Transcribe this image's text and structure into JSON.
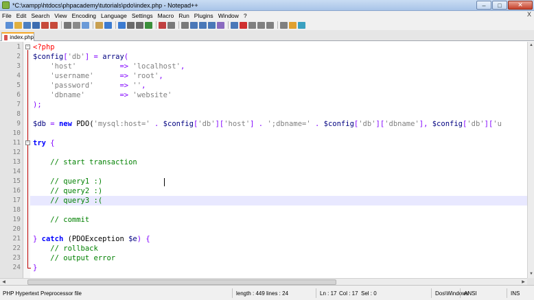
{
  "window": {
    "title": "*C:\\xampp\\htdocs\\phpacademy\\tutorials\\pdo\\index.php - Notepad++",
    "minimize": "–",
    "maximize": "□",
    "close": "✕"
  },
  "menu": {
    "items": [
      "File",
      "Edit",
      "Search",
      "View",
      "Encoding",
      "Language",
      "Settings",
      "Macro",
      "Run",
      "Plugins",
      "Window",
      "?"
    ],
    "close_glyph": "X"
  },
  "toolbar": {
    "icons": [
      "new-file-icon",
      "open-file-icon",
      "save-icon",
      "save-all-icon",
      "close-icon",
      "close-all-icon",
      "print-icon",
      "cut-icon",
      "copy-icon",
      "paste-icon",
      "undo-icon",
      "redo-icon",
      "find-icon",
      "replace-icon",
      "zoom-in-icon",
      "zoom-out-icon",
      "sync-v-icon",
      "sync-h-icon",
      "word-wrap-icon",
      "all-chars-icon",
      "indent-guide-icon",
      "user-lang-icon",
      "doc-map-icon",
      "record-macro-icon",
      "stop-macro-icon",
      "play-macro-icon",
      "run-macro-multiple-icon",
      "save-macro-icon",
      "spell-check-icon",
      "plugin-icon"
    ]
  },
  "tabs": [
    {
      "label": "index.php",
      "active": true
    }
  ],
  "editor": {
    "current_line": 17,
    "lines": [
      {
        "n": "1",
        "tokens": [
          {
            "t": "<?php",
            "c": "php-tag"
          }
        ]
      },
      {
        "n": "2",
        "tokens": [
          {
            "t": "$config",
            "c": "var"
          },
          {
            "t": "[",
            "c": "op"
          },
          {
            "t": "'db'",
            "c": "str"
          },
          {
            "t": "] = ",
            "c": "op"
          },
          {
            "t": "array",
            "c": "fn"
          },
          {
            "t": "(",
            "c": "op"
          }
        ]
      },
      {
        "n": "3",
        "tokens": [
          {
            "t": "    'host'          ",
            "c": "str"
          },
          {
            "t": "=> ",
            "c": "op"
          },
          {
            "t": "'localhost'",
            "c": "str"
          },
          {
            "t": ",",
            "c": "op"
          }
        ]
      },
      {
        "n": "4",
        "tokens": [
          {
            "t": "    'username'      ",
            "c": "str"
          },
          {
            "t": "=> ",
            "c": "op"
          },
          {
            "t": "'root'",
            "c": "str"
          },
          {
            "t": ",",
            "c": "op"
          }
        ]
      },
      {
        "n": "5",
        "tokens": [
          {
            "t": "    'password'      ",
            "c": "str"
          },
          {
            "t": "=> ",
            "c": "op"
          },
          {
            "t": "''",
            "c": "str"
          },
          {
            "t": ",",
            "c": "op"
          }
        ]
      },
      {
        "n": "6",
        "tokens": [
          {
            "t": "    'dbname'        ",
            "c": "str"
          },
          {
            "t": "=> ",
            "c": "op"
          },
          {
            "t": "'website'",
            "c": "str"
          }
        ]
      },
      {
        "n": "7",
        "tokens": [
          {
            "t": ");",
            "c": "op"
          }
        ]
      },
      {
        "n": "8",
        "tokens": []
      },
      {
        "n": "9",
        "tokens": [
          {
            "t": "$db",
            "c": "var"
          },
          {
            "t": " = ",
            "c": "op"
          },
          {
            "t": "new",
            "c": "kw"
          },
          {
            "t": " PDO(",
            "c": "plain"
          },
          {
            "t": "'mysql:host='",
            "c": "str"
          },
          {
            "t": " . ",
            "c": "op"
          },
          {
            "t": "$config",
            "c": "var"
          },
          {
            "t": "[",
            "c": "op"
          },
          {
            "t": "'db'",
            "c": "str"
          },
          {
            "t": "][",
            "c": "op"
          },
          {
            "t": "'host'",
            "c": "str"
          },
          {
            "t": "] . ",
            "c": "op"
          },
          {
            "t": "';dbname='",
            "c": "str"
          },
          {
            "t": " . ",
            "c": "op"
          },
          {
            "t": "$config",
            "c": "var"
          },
          {
            "t": "[",
            "c": "op"
          },
          {
            "t": "'db'",
            "c": "str"
          },
          {
            "t": "][",
            "c": "op"
          },
          {
            "t": "'dbname'",
            "c": "str"
          },
          {
            "t": "], ",
            "c": "op"
          },
          {
            "t": "$config",
            "c": "var"
          },
          {
            "t": "[",
            "c": "op"
          },
          {
            "t": "'db'",
            "c": "str"
          },
          {
            "t": "][",
            "c": "op"
          },
          {
            "t": "'u",
            "c": "str"
          }
        ]
      },
      {
        "n": "10",
        "tokens": []
      },
      {
        "n": "11",
        "tokens": [
          {
            "t": "try",
            "c": "kw"
          },
          {
            "t": " {",
            "c": "op"
          }
        ]
      },
      {
        "n": "12",
        "tokens": []
      },
      {
        "n": "13",
        "tokens": [
          {
            "t": "    // start transaction",
            "c": "cm"
          }
        ]
      },
      {
        "n": "14",
        "tokens": []
      },
      {
        "n": "15",
        "tokens": [
          {
            "t": "    // query1 :)",
            "c": "cm"
          }
        ]
      },
      {
        "n": "16",
        "tokens": [
          {
            "t": "    // query2 :)",
            "c": "cm"
          }
        ]
      },
      {
        "n": "17",
        "tokens": [
          {
            "t": "    // query3 :(",
            "c": "cm"
          }
        ]
      },
      {
        "n": "18",
        "tokens": []
      },
      {
        "n": "19",
        "tokens": [
          {
            "t": "    // commit",
            "c": "cm"
          }
        ]
      },
      {
        "n": "20",
        "tokens": []
      },
      {
        "n": "21",
        "tokens": [
          {
            "t": "} ",
            "c": "op"
          },
          {
            "t": "catch",
            "c": "kw"
          },
          {
            "t": " (PDOException ",
            "c": "plain"
          },
          {
            "t": "$e",
            "c": "var"
          },
          {
            "t": ") {",
            "c": "op"
          }
        ]
      },
      {
        "n": "22",
        "tokens": [
          {
            "t": "    // rollback",
            "c": "cm"
          }
        ]
      },
      {
        "n": "23",
        "tokens": [
          {
            "t": "    // output error",
            "c": "cm"
          }
        ]
      },
      {
        "n": "24",
        "tokens": [
          {
            "t": "}",
            "c": "op"
          }
        ]
      }
    ]
  },
  "status": {
    "language": "PHP Hypertext Preprocessor file",
    "length": "length : 449",
    "lines": "lines : 24",
    "ln": "Ln : 17",
    "col": "Col : 17",
    "sel": "Sel : 0",
    "eol": "Dos\\Windows",
    "encoding": "ANSI",
    "mode": "INS"
  },
  "colors": {
    "php_tag": "#ff0000",
    "keyword": "#0000ff",
    "comment": "#008000",
    "string": "#808080",
    "operator": "#8000ff",
    "variable": "#000080",
    "current_line": "#e8e8ff",
    "tab_accent": "#f5a623"
  }
}
